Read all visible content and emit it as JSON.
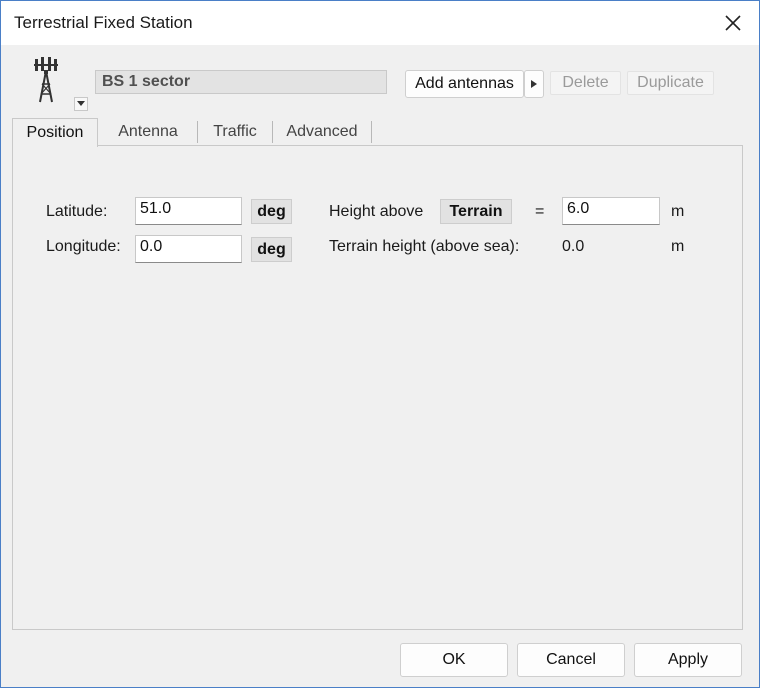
{
  "window": {
    "title": "Terrestrial Fixed Station"
  },
  "icons": {
    "close": "close-icon",
    "station": "antenna-tower-icon",
    "dropdown": "triangle-down-icon",
    "arrow": "triangle-right-icon"
  },
  "header": {
    "station_name": "BS 1 sector",
    "add_antennas_label": "Add antennas",
    "delete_label": "Delete",
    "duplicate_label": "Duplicate"
  },
  "tabs": [
    {
      "label": "Position",
      "active": true
    },
    {
      "label": "Antenna",
      "active": false
    },
    {
      "label": "Traffic",
      "active": false
    },
    {
      "label": "Advanced",
      "active": false
    }
  ],
  "position": {
    "latitude_label": "Latitude:",
    "latitude_value": "51.0",
    "latitude_unit": "deg",
    "longitude_label": "Longitude:",
    "longitude_value": "0.0",
    "longitude_unit": "deg",
    "height_above_label": "Height above",
    "height_reference": "Terrain",
    "equals": "=",
    "height_value": "6.0",
    "height_unit": "m",
    "terrain_height_label": "Terrain height (above sea):",
    "terrain_height_value": "0.0",
    "terrain_height_unit": "m"
  },
  "footer": {
    "ok_label": "OK",
    "cancel_label": "Cancel",
    "apply_label": "Apply"
  },
  "colors": {
    "window_border": "#4a7fc7",
    "background": "#f0f0f0"
  }
}
